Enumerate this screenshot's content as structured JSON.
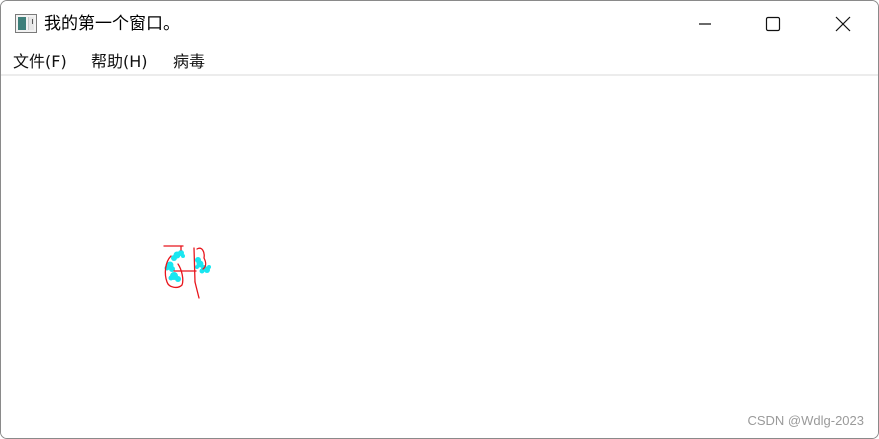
{
  "window": {
    "title": "我的第一个窗口。",
    "icon": "window-app-icon",
    "controls": {
      "minimize_icon": "minimize-icon",
      "maximize_icon": "maximize-icon",
      "close_icon": "close-icon"
    }
  },
  "menubar": {
    "items": [
      {
        "label": "文件(F)"
      },
      {
        "label": "帮助(H)"
      },
      {
        "label": "病毒"
      }
    ]
  },
  "canvas": {
    "drawing_colors": {
      "stroke": "#e8151c",
      "spray": "#19e6f0"
    }
  },
  "watermark": "CSDN @Wdlg-2023"
}
